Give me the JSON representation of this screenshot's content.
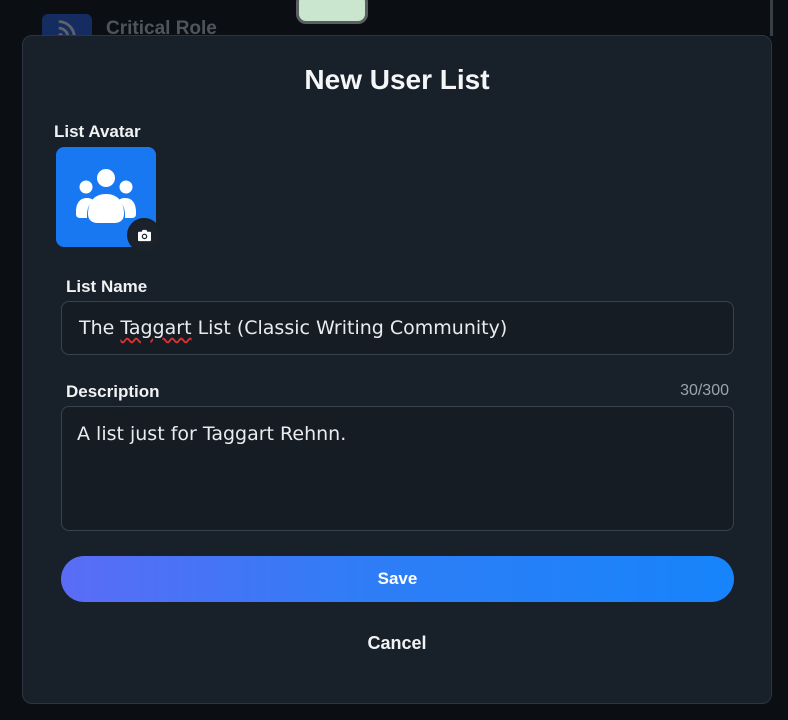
{
  "background": {
    "list_title": "Critical Role"
  },
  "modal": {
    "title": "New User List",
    "avatar_label": "List Avatar",
    "name_label": "List Name",
    "name_value_before": "The ",
    "name_value_typo": "Taggart",
    "name_value_after": " List (Classic Writing Community)",
    "description_label": "Description",
    "description_counter": "30/300",
    "description_value": "A list just for Taggart Rehnn.",
    "save_label": "Save",
    "cancel_label": "Cancel"
  },
  "colors": {
    "accent": "#1778f2",
    "save_gradient_start": "#5b6cf5",
    "save_gradient_end": "#1784fb"
  },
  "icons": {
    "avatar": "group-icon",
    "badge": "camera-icon",
    "background": "rss-icon"
  }
}
